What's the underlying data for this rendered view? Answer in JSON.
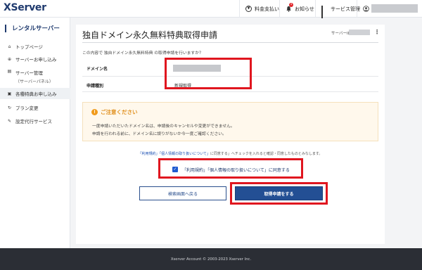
{
  "header": {
    "logo": "XServer",
    "payment_label": "料金支払い",
    "notifications_label": "お知らせ",
    "notifications_badge": "1",
    "services_label": "サービス管理"
  },
  "sidebar": {
    "title": "レンタルサーバー",
    "items": [
      {
        "label": "トップページ",
        "icon": "home-icon"
      },
      {
        "label": "サーバーお申し込み",
        "icon": "plus-circle-icon"
      },
      {
        "label": "サーバー管理",
        "sub": "（サーバーパネル）",
        "icon": "server-icon"
      },
      {
        "label": "各種特典お申し込み",
        "icon": "gift-icon"
      },
      {
        "label": "プラン変更",
        "icon": "refresh-icon"
      },
      {
        "label": "設定代行サービス",
        "icon": "tools-icon"
      }
    ]
  },
  "main": {
    "title": "独自ドメイン永久無料特典取得申請",
    "server_id_label": "サーバーID",
    "intro": "この内容で 独自ドメイン永久無料特典 の取得申請を行いますか？",
    "rows": [
      {
        "label": "ドメイン名",
        "value": ""
      },
      {
        "label": "申請種別",
        "value": "新規取得"
      }
    ],
    "caution": {
      "title": "ご注意ください",
      "line1": "一度申請いただいたドメイン名は、申請後のキャンセルや変更ができません。",
      "line2": "申請を行われる前に、ドメイン名に誤りがないか今一度ご確認ください。"
    },
    "agree_note_link1": "「利用規約」",
    "agree_note_mid": "「個人情報の取り扱いについて」",
    "agree_note_rest": "に同意する」へチェックを入れると確認・同意したものとみなします。",
    "agree_checkbox_label": "「利用規約」「個人情報の取り扱いについて」に同意する",
    "back_button": "検索画面へ戻る",
    "submit_button": "取得申請をする"
  },
  "footer": {
    "copyright": "Xserver Account © 2003-2023 Xserver Inc."
  },
  "colors": {
    "brand": "#1f3a6e",
    "primary_button": "#234f94",
    "highlight": "#e0161f",
    "caution_text": "#e0901e"
  }
}
